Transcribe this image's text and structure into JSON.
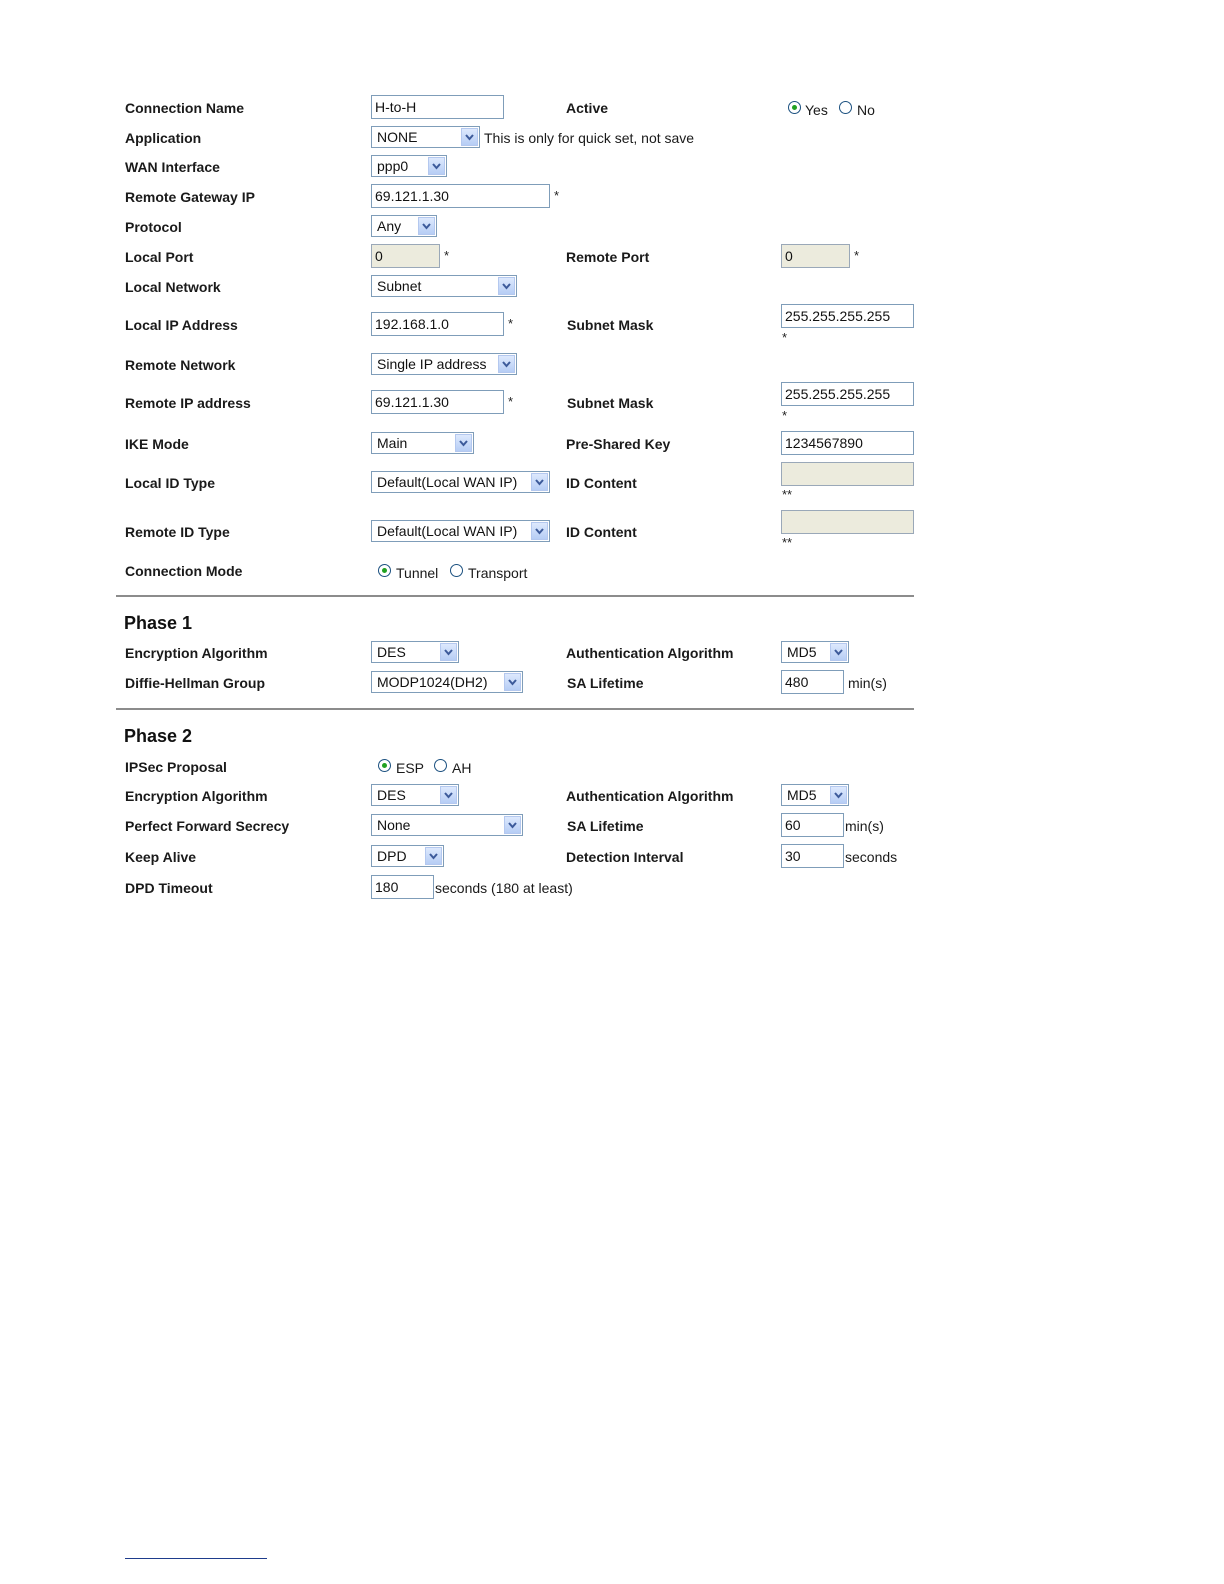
{
  "general": {
    "connection_name": {
      "label": "Connection Name",
      "value": "H-to-H"
    },
    "active": {
      "label": "Active",
      "yes": "Yes",
      "no": "No",
      "selected": "Yes"
    },
    "application": {
      "label": "Application",
      "value": "NONE",
      "note": "This is only for quick set, not save"
    },
    "wan_interface": {
      "label": "WAN Interface",
      "value": "ppp0"
    },
    "remote_gateway_ip": {
      "label": "Remote Gateway IP",
      "value": "69.121.1.30",
      "required": "*"
    },
    "protocol": {
      "label": "Protocol",
      "value": "Any"
    },
    "local_port": {
      "label": "Local Port",
      "value": "0",
      "required": "*"
    },
    "remote_port": {
      "label": "Remote Port",
      "value": "0",
      "required": "*"
    },
    "local_network": {
      "label": "Local Network",
      "value": "Subnet"
    },
    "local_ip_address": {
      "label": "Local IP Address",
      "value": "192.168.1.0",
      "required": "*"
    },
    "local_subnet_mask": {
      "label": "Subnet Mask",
      "value": "255.255.255.255",
      "required": "*"
    },
    "remote_network": {
      "label": "Remote Network",
      "value": "Single IP address"
    },
    "remote_ip_address": {
      "label": "Remote IP address",
      "value": "69.121.1.30",
      "required": "*"
    },
    "remote_subnet_mask": {
      "label": "Subnet Mask",
      "value": "255.255.255.255",
      "required": "*"
    },
    "ike_mode": {
      "label": "IKE Mode",
      "value": "Main"
    },
    "pre_shared_key": {
      "label": "Pre-Shared Key",
      "value": "1234567890"
    },
    "local_id_type": {
      "label": "Local ID Type",
      "value": "Default(Local WAN IP)"
    },
    "local_id_content": {
      "label": "ID Content",
      "value": "",
      "required": "**"
    },
    "remote_id_type": {
      "label": "Remote ID Type",
      "value": "Default(Local WAN IP)"
    },
    "remote_id_content": {
      "label": "ID Content",
      "value": "",
      "required": "**"
    },
    "connection_mode": {
      "label": "Connection Mode",
      "tunnel": "Tunnel",
      "transport": "Transport",
      "selected": "Tunnel"
    }
  },
  "phase1": {
    "title": "Phase 1",
    "encryption_algorithm": {
      "label": "Encryption Algorithm",
      "value": "DES"
    },
    "authentication_algorithm": {
      "label": "Authentication Algorithm",
      "value": "MD5"
    },
    "dh_group": {
      "label": "Diffie-Hellman Group",
      "value": "MODP1024(DH2)"
    },
    "sa_lifetime": {
      "label": "SA Lifetime",
      "value": "480",
      "unit": "min(s)"
    }
  },
  "phase2": {
    "title": "Phase 2",
    "ipsec_proposal": {
      "label": "IPSec Proposal",
      "esp": "ESP",
      "ah": "AH",
      "selected": "ESP"
    },
    "encryption_algorithm": {
      "label": "Encryption Algorithm",
      "value": "DES"
    },
    "authentication_algorithm": {
      "label": "Authentication Algorithm",
      "value": "MD5"
    },
    "pfs": {
      "label": "Perfect Forward Secrecy",
      "value": "None"
    },
    "sa_lifetime": {
      "label": "SA Lifetime",
      "value": "60",
      "unit": "min(s)"
    },
    "keep_alive": {
      "label": "Keep Alive",
      "value": "DPD"
    },
    "detection_interval": {
      "label": "Detection Interval",
      "value": "30",
      "unit": "seconds"
    },
    "dpd_timeout": {
      "label": "DPD Timeout",
      "value": "180",
      "unit": "seconds (180 at least)"
    }
  },
  "colors": {
    "radio_selected": "#21a121",
    "input_border": "#7f9db9",
    "disabled_field": "#ecebdd"
  },
  "icons": {
    "dropdown": "chevron-down-icon"
  }
}
